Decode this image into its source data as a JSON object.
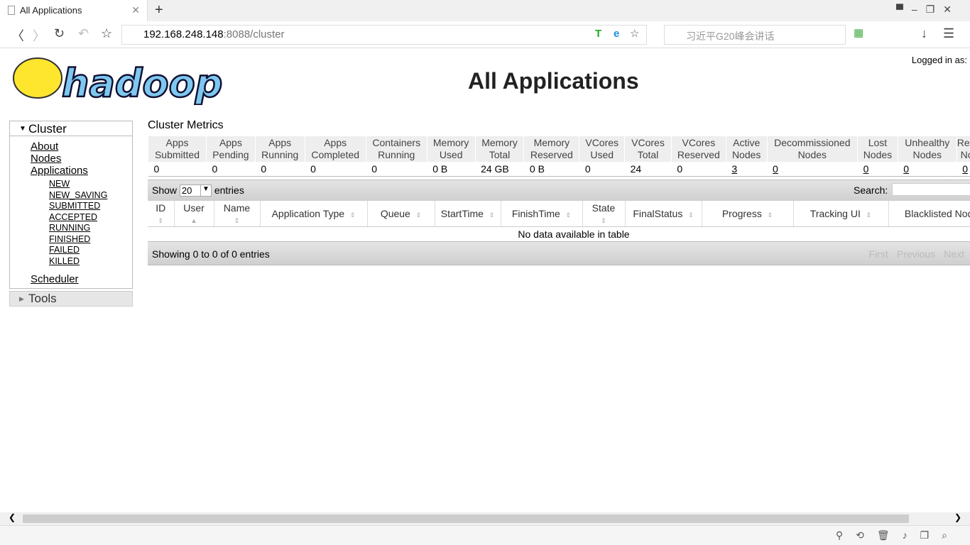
{
  "browser": {
    "tab_title": "All Applications",
    "url_host": "192.168.248.148",
    "url_rest": ":8088/cluster",
    "search_placeholder": "习近平G20峰会讲话"
  },
  "header": {
    "logo_text": "hadoop",
    "title": "All Applications",
    "logged_in": "Logged in as:"
  },
  "sidebar": {
    "cluster": "Cluster",
    "items": [
      "About",
      "Nodes",
      "Applications"
    ],
    "states": [
      "NEW",
      "NEW_SAVING",
      "SUBMITTED",
      "ACCEPTED",
      "RUNNING",
      "FINISHED",
      "FAILED",
      "KILLED"
    ],
    "scheduler": "Scheduler",
    "tools": "Tools"
  },
  "metrics": {
    "title": "Cluster Metrics",
    "headers": [
      [
        "Apps",
        "Submitted"
      ],
      [
        "Apps",
        "Pending"
      ],
      [
        "Apps",
        "Running"
      ],
      [
        "Apps",
        "Completed"
      ],
      [
        "Containers",
        "Running"
      ],
      [
        "Memory",
        "Used"
      ],
      [
        "Memory",
        "Total"
      ],
      [
        "Memory",
        "Reserved"
      ],
      [
        "VCores",
        "Used"
      ],
      [
        "VCores",
        "Total"
      ],
      [
        "VCores",
        "Reserved"
      ],
      [
        "Active",
        "Nodes"
      ],
      [
        "Decommissioned",
        "Nodes"
      ],
      [
        "Lost",
        "Nodes"
      ],
      [
        "Unhealthy",
        "Nodes"
      ],
      [
        "Rebooted",
        "Nodes"
      ]
    ],
    "values": [
      "0",
      "0",
      "0",
      "0",
      "0",
      "0 B",
      "24 GB",
      "0 B",
      "0",
      "24",
      "0",
      "3",
      "0",
      "0",
      "0",
      "0"
    ]
  },
  "table": {
    "show": "Show",
    "page_size": "20",
    "entries": "entries",
    "search_label": "Search:",
    "columns": [
      "ID",
      "User",
      "Name",
      "Application Type",
      "Queue",
      "StartTime",
      "FinishTime",
      "State",
      "FinalStatus",
      "Progress",
      "Tracking UI",
      "Blacklisted Nodes"
    ],
    "empty": "No data available in table",
    "info": "Showing 0 to 0 of 0 entries",
    "first": "First",
    "previous": "Previous",
    "next": "Next"
  }
}
